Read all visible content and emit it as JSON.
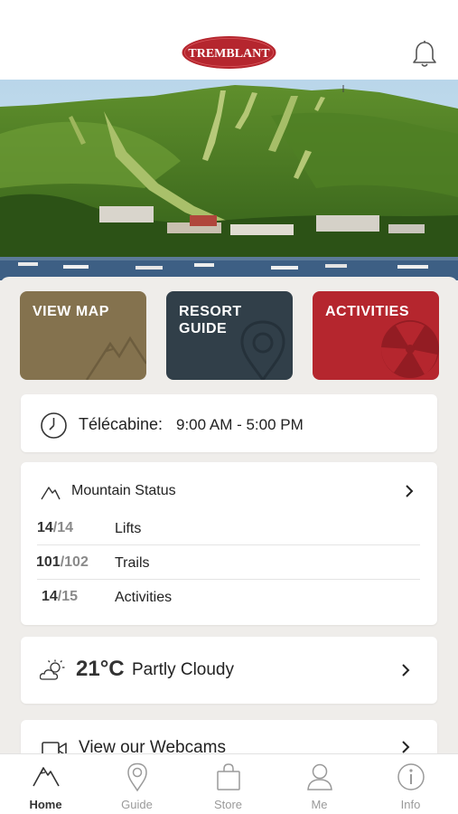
{
  "header": {
    "logo_text": "TREMBLANT",
    "icons": {
      "notifications": "bell-icon"
    }
  },
  "colors": {
    "brand_red": "#b5262e",
    "map_tile": "#84724e",
    "guide_tile": "#313f49",
    "activities_tile": "#b5262e"
  },
  "tiles": [
    {
      "label": "VIEW MAP",
      "icon": "mountain-icon"
    },
    {
      "label": "RESORT\nGUIDE",
      "icon": "map-pin-icon"
    },
    {
      "label": "ACTIVITIES",
      "icon": "activity-icon"
    }
  ],
  "hours": {
    "label": "Télécabine:",
    "value": "9:00 AM - 5:00 PM",
    "icon": "clock-icon"
  },
  "mountain_status": {
    "title": "Mountain Status",
    "icon": "mountain-icon",
    "rows": [
      {
        "open": "14",
        "total": "/14",
        "label": "Lifts"
      },
      {
        "open": "101",
        "total": "/102",
        "label": "Trails"
      },
      {
        "open": "14",
        "total": "/15",
        "label": "Activities"
      }
    ]
  },
  "weather": {
    "temperature": "21°C",
    "condition": "Partly Cloudy",
    "icon": "partly-cloudy-icon"
  },
  "webcams": {
    "label": "View our Webcams",
    "icon": "video-camera-icon"
  },
  "tabbar": {
    "items": [
      {
        "label": "Home",
        "icon": "mountain-icon",
        "active": true
      },
      {
        "label": "Guide",
        "icon": "map-pin-icon",
        "active": false
      },
      {
        "label": "Store",
        "icon": "shopping-bag-icon",
        "active": false
      },
      {
        "label": "Me",
        "icon": "user-icon",
        "active": false
      },
      {
        "label": "Info",
        "icon": "info-icon",
        "active": false
      }
    ]
  }
}
